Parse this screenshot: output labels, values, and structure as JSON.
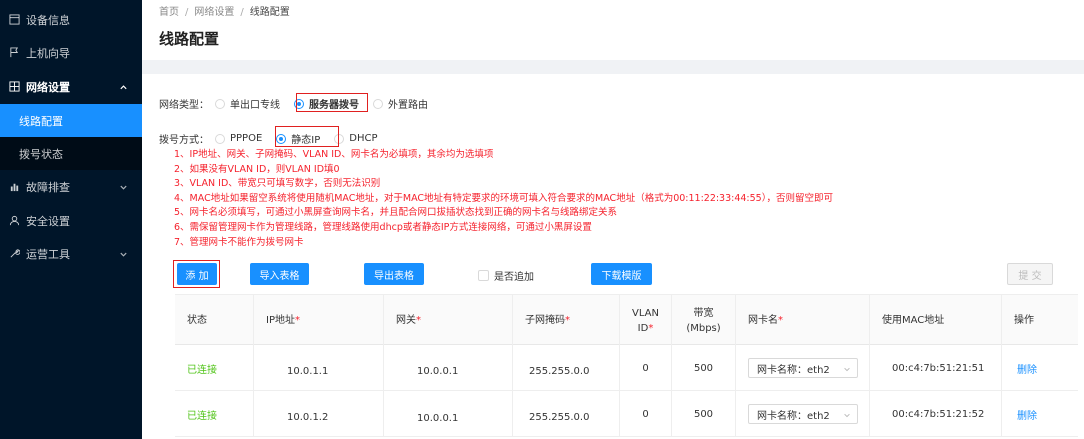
{
  "sidebar": {
    "items": [
      {
        "label": "设备信息",
        "icon": "monitor-icon"
      },
      {
        "label": "上机向导",
        "icon": "flag-icon"
      },
      {
        "label": "网络设置",
        "icon": "grid-icon",
        "expanded": true
      },
      {
        "label": "故障排查",
        "icon": "chart-icon"
      },
      {
        "label": "安全设置",
        "icon": "user-icon"
      },
      {
        "label": "运营工具",
        "icon": "wrench-icon"
      }
    ],
    "subitems": [
      {
        "label": "线路配置",
        "active": true
      },
      {
        "label": "拨号状态",
        "active": false
      }
    ]
  },
  "breadcrumb": {
    "home": "首页",
    "sep": "/",
    "level2": "网络设置",
    "current": "线路配置"
  },
  "page_title": "线路配置",
  "network_type": {
    "label": "网络类型：",
    "options": [
      "单出口专线",
      "服务器拨号",
      "外置路由"
    ],
    "selected": "服务器拨号"
  },
  "dial_mode": {
    "label": "拨号方式：",
    "options": [
      "PPPOE",
      "静态IP",
      "DHCP"
    ],
    "selected": "静态IP"
  },
  "notes": [
    "1、IP地址、网关、子网掩码、VLAN ID、网卡名为必填项，其余均为选填项",
    "2、如果没有VLAN ID，则VLAN ID填0",
    "3、VLAN ID、带宽只可填写数字，否则无法识别",
    "4、MAC地址如果留空系统将使用随机MAC地址，对于MAC地址有特定要求的环境可填入符合要求的MAC地址（格式为00:11:22:33:44:55），否则留空即可",
    "5、网卡名必须填写，可通过小黑屏查询网卡名，并且配合网口拔插状态找到正确的网卡名与线路绑定关系",
    "6、需保留管理网卡作为管理线路，管理线路使用dhcp或者静态IP方式连接网络，可通过小黑屏设置",
    "7、管理网卡不能作为拨号网卡"
  ],
  "toolbar": {
    "add": "添 加",
    "import": "导入表格",
    "export": "导出表格",
    "append": "是否追加",
    "download": "下载模版",
    "submit": "提 交"
  },
  "table": {
    "headers": {
      "status": "状态",
      "ip": "IP地址",
      "gateway": "网关",
      "mask": "子网掩码",
      "vlan1": "VLAN",
      "vlan2": "ID",
      "bw1": "带宽",
      "bw2": "(Mbps)",
      "nic": "网卡名",
      "mac": "使用MAC地址",
      "op": "操作",
      "req": "*"
    },
    "rows": [
      {
        "status": "已连接",
        "ip": "10.0.1.1",
        "gateway": "10.0.0.1",
        "mask": "255.255.0.0",
        "vlan": "0",
        "bw": "500",
        "nic": "网卡名称：eth2",
        "mac": "00:c4:7b:51:21:51",
        "op": "删除"
      },
      {
        "status": "已连接",
        "ip": "10.0.1.2",
        "gateway": "10.0.0.1",
        "mask": "255.255.0.0",
        "vlan": "0",
        "bw": "500",
        "nic": "网卡名称：eth2",
        "mac": "00:c4:7b:51:21:52",
        "op": "删除"
      }
    ]
  },
  "colors": {
    "primary": "#1890ff",
    "sidebar": "#001529",
    "danger": "#f5222d",
    "success": "#52c41a"
  }
}
